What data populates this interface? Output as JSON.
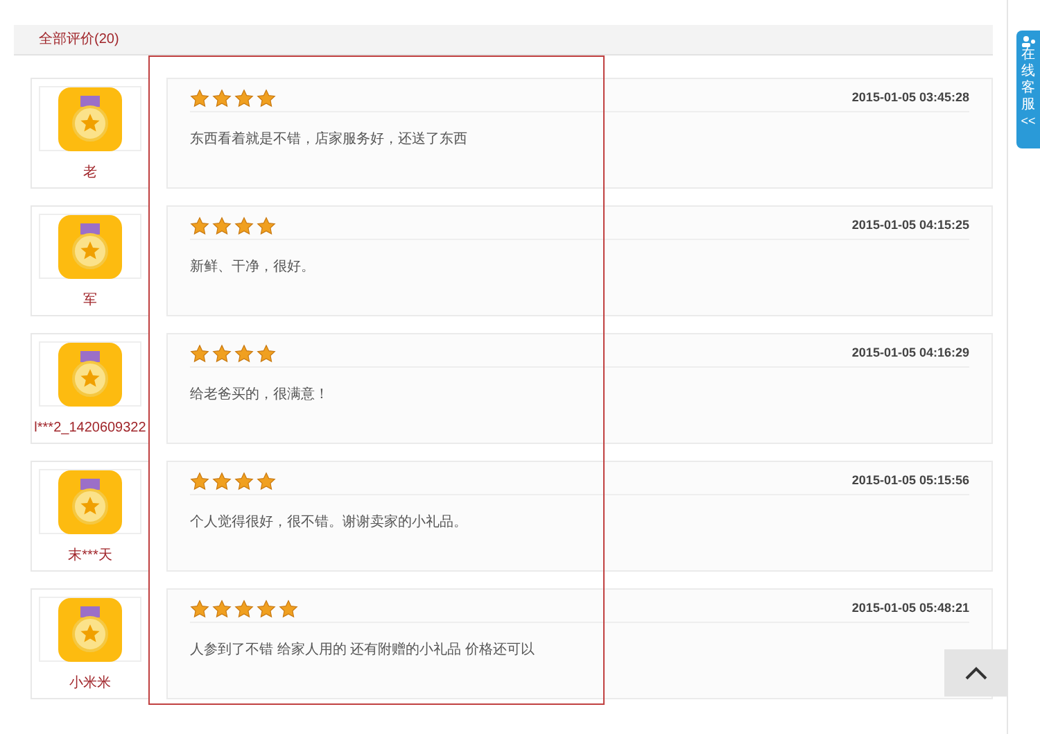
{
  "tabs": [
    {
      "label": "全部评价(20)",
      "selected": true
    }
  ],
  "reviews": [
    {
      "user": "老",
      "stars": 4,
      "time": "2015-01-05 03:45:28",
      "text": "东西看着就是不错，店家服务好，还送了东西"
    },
    {
      "user": "军",
      "stars": 4,
      "time": "2015-01-05 04:15:25",
      "text": "新鲜、干净，很好。"
    },
    {
      "user": "l***2_1420609322",
      "stars": 4,
      "time": "2015-01-05 04:16:29",
      "text": "给老爸买的，很满意！"
    },
    {
      "user": "末***天",
      "stars": 4,
      "time": "2015-01-05 05:15:56",
      "text": "个人觉得很好，很不错。谢谢卖家的小礼品。"
    },
    {
      "user": "小米米",
      "stars": 5,
      "time": "2015-01-05 05:48:21",
      "text": "人参到了不错 给家人用的 还有附赠的小礼品 价格还可以"
    }
  ],
  "service_tab": {
    "chars": [
      "在",
      "线",
      "客",
      "服"
    ],
    "arrow": "<<"
  }
}
